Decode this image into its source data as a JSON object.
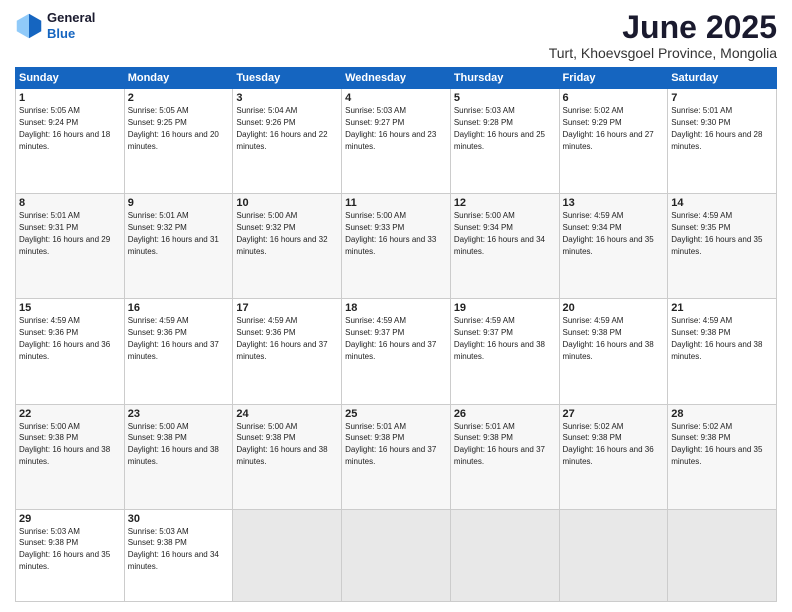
{
  "header": {
    "logo_line1": "General",
    "logo_line2": "Blue",
    "month_title": "June 2025",
    "subtitle": "Turt, Khoevsgoel Province, Mongolia"
  },
  "days_of_week": [
    "Sunday",
    "Monday",
    "Tuesday",
    "Wednesday",
    "Thursday",
    "Friday",
    "Saturday"
  ],
  "weeks": [
    [
      {
        "day": "1",
        "rise": "5:05 AM",
        "set": "9:24 PM",
        "daylight": "16 hours and 18 minutes."
      },
      {
        "day": "2",
        "rise": "5:05 AM",
        "set": "9:25 PM",
        "daylight": "16 hours and 20 minutes."
      },
      {
        "day": "3",
        "rise": "5:04 AM",
        "set": "9:26 PM",
        "daylight": "16 hours and 22 minutes."
      },
      {
        "day": "4",
        "rise": "5:03 AM",
        "set": "9:27 PM",
        "daylight": "16 hours and 23 minutes."
      },
      {
        "day": "5",
        "rise": "5:03 AM",
        "set": "9:28 PM",
        "daylight": "16 hours and 25 minutes."
      },
      {
        "day": "6",
        "rise": "5:02 AM",
        "set": "9:29 PM",
        "daylight": "16 hours and 27 minutes."
      },
      {
        "day": "7",
        "rise": "5:01 AM",
        "set": "9:30 PM",
        "daylight": "16 hours and 28 minutes."
      }
    ],
    [
      {
        "day": "8",
        "rise": "5:01 AM",
        "set": "9:31 PM",
        "daylight": "16 hours and 29 minutes."
      },
      {
        "day": "9",
        "rise": "5:01 AM",
        "set": "9:32 PM",
        "daylight": "16 hours and 31 minutes."
      },
      {
        "day": "10",
        "rise": "5:00 AM",
        "set": "9:32 PM",
        "daylight": "16 hours and 32 minutes."
      },
      {
        "day": "11",
        "rise": "5:00 AM",
        "set": "9:33 PM",
        "daylight": "16 hours and 33 minutes."
      },
      {
        "day": "12",
        "rise": "5:00 AM",
        "set": "9:34 PM",
        "daylight": "16 hours and 34 minutes."
      },
      {
        "day": "13",
        "rise": "4:59 AM",
        "set": "9:34 PM",
        "daylight": "16 hours and 35 minutes."
      },
      {
        "day": "14",
        "rise": "4:59 AM",
        "set": "9:35 PM",
        "daylight": "16 hours and 35 minutes."
      }
    ],
    [
      {
        "day": "15",
        "rise": "4:59 AM",
        "set": "9:36 PM",
        "daylight": "16 hours and 36 minutes."
      },
      {
        "day": "16",
        "rise": "4:59 AM",
        "set": "9:36 PM",
        "daylight": "16 hours and 37 minutes."
      },
      {
        "day": "17",
        "rise": "4:59 AM",
        "set": "9:36 PM",
        "daylight": "16 hours and 37 minutes."
      },
      {
        "day": "18",
        "rise": "4:59 AM",
        "set": "9:37 PM",
        "daylight": "16 hours and 37 minutes."
      },
      {
        "day": "19",
        "rise": "4:59 AM",
        "set": "9:37 PM",
        "daylight": "16 hours and 38 minutes."
      },
      {
        "day": "20",
        "rise": "4:59 AM",
        "set": "9:38 PM",
        "daylight": "16 hours and 38 minutes."
      },
      {
        "day": "21",
        "rise": "4:59 AM",
        "set": "9:38 PM",
        "daylight": "16 hours and 38 minutes."
      }
    ],
    [
      {
        "day": "22",
        "rise": "5:00 AM",
        "set": "9:38 PM",
        "daylight": "16 hours and 38 minutes."
      },
      {
        "day": "23",
        "rise": "5:00 AM",
        "set": "9:38 PM",
        "daylight": "16 hours and 38 minutes."
      },
      {
        "day": "24",
        "rise": "5:00 AM",
        "set": "9:38 PM",
        "daylight": "16 hours and 38 minutes."
      },
      {
        "day": "25",
        "rise": "5:01 AM",
        "set": "9:38 PM",
        "daylight": "16 hours and 37 minutes."
      },
      {
        "day": "26",
        "rise": "5:01 AM",
        "set": "9:38 PM",
        "daylight": "16 hours and 37 minutes."
      },
      {
        "day": "27",
        "rise": "5:02 AM",
        "set": "9:38 PM",
        "daylight": "16 hours and 36 minutes."
      },
      {
        "day": "28",
        "rise": "5:02 AM",
        "set": "9:38 PM",
        "daylight": "16 hours and 35 minutes."
      }
    ],
    [
      {
        "day": "29",
        "rise": "5:03 AM",
        "set": "9:38 PM",
        "daylight": "16 hours and 35 minutes."
      },
      {
        "day": "30",
        "rise": "5:03 AM",
        "set": "9:38 PM",
        "daylight": "16 hours and 34 minutes."
      },
      null,
      null,
      null,
      null,
      null
    ]
  ]
}
